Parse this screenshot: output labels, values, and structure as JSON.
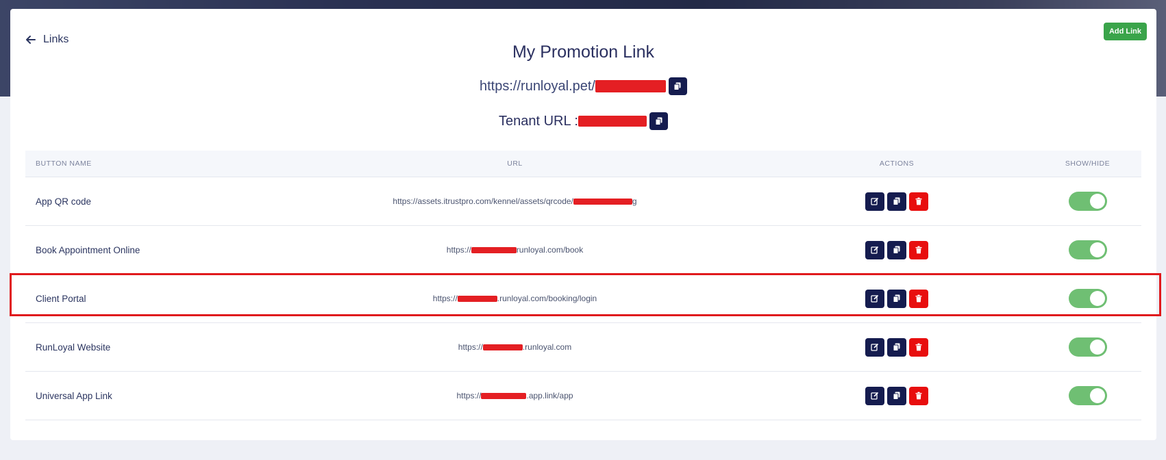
{
  "header": {
    "back_label": "Links",
    "add_button": "Add Link"
  },
  "promotion": {
    "title": "My Promotion Link",
    "link_prefix": "https://runloyal.pet/",
    "tenant_label": "Tenant URL : "
  },
  "table": {
    "columns": [
      "BUTTON NAME",
      "URL",
      "ACTIONS",
      "SHOW/HIDE"
    ],
    "rows": [
      {
        "name": "App QR code",
        "url_prefix": "https://assets.itrustpro.com/kennel/assets/qrcode/",
        "url_suffix": "g",
        "shown": true
      },
      {
        "name": "Book Appointment Online",
        "url_prefix": "https://",
        "url_suffix": "runloyal.com/book",
        "shown": true
      },
      {
        "name": "Client Portal",
        "url_prefix": "https://",
        "url_suffix": ".runloyal.com/booking/login",
        "shown": true
      },
      {
        "name": "RunLoyal Website",
        "url_prefix": "https://",
        "url_suffix": ".runloyal.com",
        "shown": true
      },
      {
        "name": "Universal App Link",
        "url_prefix": "https://",
        "url_suffix": ".app.link/app",
        "shown": true
      }
    ]
  },
  "colors": {
    "primary_dark": "#151c4f",
    "delete_red": "#e80e0e",
    "add_green": "#3aa44a",
    "toggle_on": "#6fbf73",
    "highlight": "#e0191c"
  },
  "icons": {
    "back": "arrow-left-icon",
    "copy": "copy-icon",
    "edit": "edit-icon",
    "delete": "trash-icon"
  }
}
